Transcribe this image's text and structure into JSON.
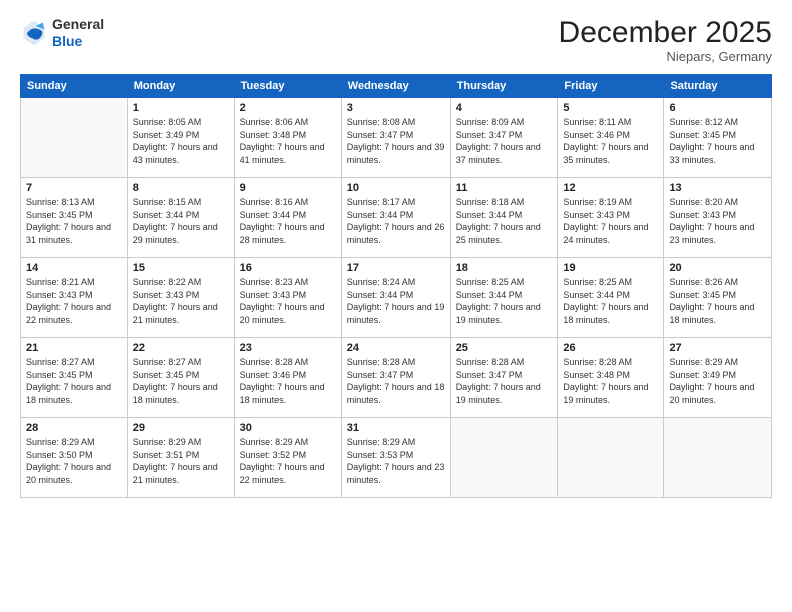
{
  "logo": {
    "line1": "General",
    "line2": "Blue"
  },
  "title": "December 2025",
  "subtitle": "Niepars, Germany",
  "days_of_week": [
    "Sunday",
    "Monday",
    "Tuesday",
    "Wednesday",
    "Thursday",
    "Friday",
    "Saturday"
  ],
  "weeks": [
    [
      {
        "day": "",
        "sunrise": "",
        "sunset": "",
        "daylight": ""
      },
      {
        "day": "1",
        "sunrise": "Sunrise: 8:05 AM",
        "sunset": "Sunset: 3:49 PM",
        "daylight": "Daylight: 7 hours and 43 minutes."
      },
      {
        "day": "2",
        "sunrise": "Sunrise: 8:06 AM",
        "sunset": "Sunset: 3:48 PM",
        "daylight": "Daylight: 7 hours and 41 minutes."
      },
      {
        "day": "3",
        "sunrise": "Sunrise: 8:08 AM",
        "sunset": "Sunset: 3:47 PM",
        "daylight": "Daylight: 7 hours and 39 minutes."
      },
      {
        "day": "4",
        "sunrise": "Sunrise: 8:09 AM",
        "sunset": "Sunset: 3:47 PM",
        "daylight": "Daylight: 7 hours and 37 minutes."
      },
      {
        "day": "5",
        "sunrise": "Sunrise: 8:11 AM",
        "sunset": "Sunset: 3:46 PM",
        "daylight": "Daylight: 7 hours and 35 minutes."
      },
      {
        "day": "6",
        "sunrise": "Sunrise: 8:12 AM",
        "sunset": "Sunset: 3:45 PM",
        "daylight": "Daylight: 7 hours and 33 minutes."
      }
    ],
    [
      {
        "day": "7",
        "sunrise": "Sunrise: 8:13 AM",
        "sunset": "Sunset: 3:45 PM",
        "daylight": "Daylight: 7 hours and 31 minutes."
      },
      {
        "day": "8",
        "sunrise": "Sunrise: 8:15 AM",
        "sunset": "Sunset: 3:44 PM",
        "daylight": "Daylight: 7 hours and 29 minutes."
      },
      {
        "day": "9",
        "sunrise": "Sunrise: 8:16 AM",
        "sunset": "Sunset: 3:44 PM",
        "daylight": "Daylight: 7 hours and 28 minutes."
      },
      {
        "day": "10",
        "sunrise": "Sunrise: 8:17 AM",
        "sunset": "Sunset: 3:44 PM",
        "daylight": "Daylight: 7 hours and 26 minutes."
      },
      {
        "day": "11",
        "sunrise": "Sunrise: 8:18 AM",
        "sunset": "Sunset: 3:44 PM",
        "daylight": "Daylight: 7 hours and 25 minutes."
      },
      {
        "day": "12",
        "sunrise": "Sunrise: 8:19 AM",
        "sunset": "Sunset: 3:43 PM",
        "daylight": "Daylight: 7 hours and 24 minutes."
      },
      {
        "day": "13",
        "sunrise": "Sunrise: 8:20 AM",
        "sunset": "Sunset: 3:43 PM",
        "daylight": "Daylight: 7 hours and 23 minutes."
      }
    ],
    [
      {
        "day": "14",
        "sunrise": "Sunrise: 8:21 AM",
        "sunset": "Sunset: 3:43 PM",
        "daylight": "Daylight: 7 hours and 22 minutes."
      },
      {
        "day": "15",
        "sunrise": "Sunrise: 8:22 AM",
        "sunset": "Sunset: 3:43 PM",
        "daylight": "Daylight: 7 hours and 21 minutes."
      },
      {
        "day": "16",
        "sunrise": "Sunrise: 8:23 AM",
        "sunset": "Sunset: 3:43 PM",
        "daylight": "Daylight: 7 hours and 20 minutes."
      },
      {
        "day": "17",
        "sunrise": "Sunrise: 8:24 AM",
        "sunset": "Sunset: 3:44 PM",
        "daylight": "Daylight: 7 hours and 19 minutes."
      },
      {
        "day": "18",
        "sunrise": "Sunrise: 8:25 AM",
        "sunset": "Sunset: 3:44 PM",
        "daylight": "Daylight: 7 hours and 19 minutes."
      },
      {
        "day": "19",
        "sunrise": "Sunrise: 8:25 AM",
        "sunset": "Sunset: 3:44 PM",
        "daylight": "Daylight: 7 hours and 18 minutes."
      },
      {
        "day": "20",
        "sunrise": "Sunrise: 8:26 AM",
        "sunset": "Sunset: 3:45 PM",
        "daylight": "Daylight: 7 hours and 18 minutes."
      }
    ],
    [
      {
        "day": "21",
        "sunrise": "Sunrise: 8:27 AM",
        "sunset": "Sunset: 3:45 PM",
        "daylight": "Daylight: 7 hours and 18 minutes."
      },
      {
        "day": "22",
        "sunrise": "Sunrise: 8:27 AM",
        "sunset": "Sunset: 3:45 PM",
        "daylight": "Daylight: 7 hours and 18 minutes."
      },
      {
        "day": "23",
        "sunrise": "Sunrise: 8:28 AM",
        "sunset": "Sunset: 3:46 PM",
        "daylight": "Daylight: 7 hours and 18 minutes."
      },
      {
        "day": "24",
        "sunrise": "Sunrise: 8:28 AM",
        "sunset": "Sunset: 3:47 PM",
        "daylight": "Daylight: 7 hours and 18 minutes."
      },
      {
        "day": "25",
        "sunrise": "Sunrise: 8:28 AM",
        "sunset": "Sunset: 3:47 PM",
        "daylight": "Daylight: 7 hours and 19 minutes."
      },
      {
        "day": "26",
        "sunrise": "Sunrise: 8:28 AM",
        "sunset": "Sunset: 3:48 PM",
        "daylight": "Daylight: 7 hours and 19 minutes."
      },
      {
        "day": "27",
        "sunrise": "Sunrise: 8:29 AM",
        "sunset": "Sunset: 3:49 PM",
        "daylight": "Daylight: 7 hours and 20 minutes."
      }
    ],
    [
      {
        "day": "28",
        "sunrise": "Sunrise: 8:29 AM",
        "sunset": "Sunset: 3:50 PM",
        "daylight": "Daylight: 7 hours and 20 minutes."
      },
      {
        "day": "29",
        "sunrise": "Sunrise: 8:29 AM",
        "sunset": "Sunset: 3:51 PM",
        "daylight": "Daylight: 7 hours and 21 minutes."
      },
      {
        "day": "30",
        "sunrise": "Sunrise: 8:29 AM",
        "sunset": "Sunset: 3:52 PM",
        "daylight": "Daylight: 7 hours and 22 minutes."
      },
      {
        "day": "31",
        "sunrise": "Sunrise: 8:29 AM",
        "sunset": "Sunset: 3:53 PM",
        "daylight": "Daylight: 7 hours and 23 minutes."
      },
      {
        "day": "",
        "sunrise": "",
        "sunset": "",
        "daylight": ""
      },
      {
        "day": "",
        "sunrise": "",
        "sunset": "",
        "daylight": ""
      },
      {
        "day": "",
        "sunrise": "",
        "sunset": "",
        "daylight": ""
      }
    ]
  ]
}
